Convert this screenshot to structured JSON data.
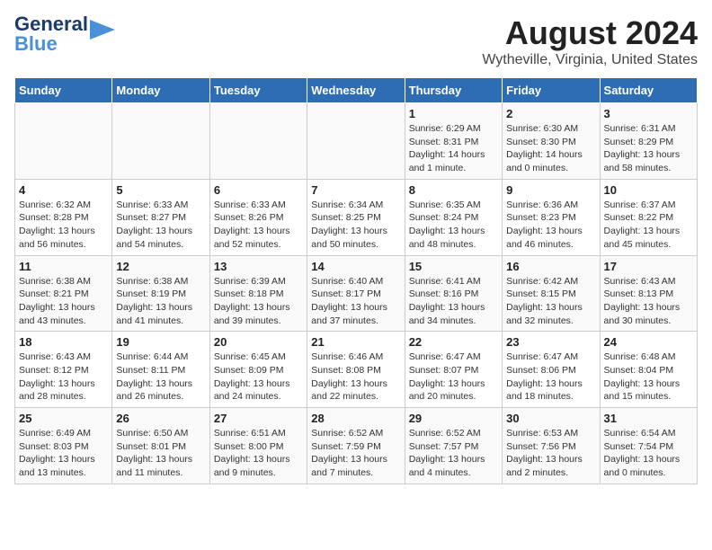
{
  "logo": {
    "line1": "General",
    "line2": "Blue"
  },
  "title": "August 2024",
  "subtitle": "Wytheville, Virginia, United States",
  "weekdays": [
    "Sunday",
    "Monday",
    "Tuesday",
    "Wednesday",
    "Thursday",
    "Friday",
    "Saturday"
  ],
  "weeks": [
    [
      {
        "day": "",
        "info": ""
      },
      {
        "day": "",
        "info": ""
      },
      {
        "day": "",
        "info": ""
      },
      {
        "day": "",
        "info": ""
      },
      {
        "day": "1",
        "info": "Sunrise: 6:29 AM\nSunset: 8:31 PM\nDaylight: 14 hours\nand 1 minute."
      },
      {
        "day": "2",
        "info": "Sunrise: 6:30 AM\nSunset: 8:30 PM\nDaylight: 14 hours\nand 0 minutes."
      },
      {
        "day": "3",
        "info": "Sunrise: 6:31 AM\nSunset: 8:29 PM\nDaylight: 13 hours\nand 58 minutes."
      }
    ],
    [
      {
        "day": "4",
        "info": "Sunrise: 6:32 AM\nSunset: 8:28 PM\nDaylight: 13 hours\nand 56 minutes."
      },
      {
        "day": "5",
        "info": "Sunrise: 6:33 AM\nSunset: 8:27 PM\nDaylight: 13 hours\nand 54 minutes."
      },
      {
        "day": "6",
        "info": "Sunrise: 6:33 AM\nSunset: 8:26 PM\nDaylight: 13 hours\nand 52 minutes."
      },
      {
        "day": "7",
        "info": "Sunrise: 6:34 AM\nSunset: 8:25 PM\nDaylight: 13 hours\nand 50 minutes."
      },
      {
        "day": "8",
        "info": "Sunrise: 6:35 AM\nSunset: 8:24 PM\nDaylight: 13 hours\nand 48 minutes."
      },
      {
        "day": "9",
        "info": "Sunrise: 6:36 AM\nSunset: 8:23 PM\nDaylight: 13 hours\nand 46 minutes."
      },
      {
        "day": "10",
        "info": "Sunrise: 6:37 AM\nSunset: 8:22 PM\nDaylight: 13 hours\nand 45 minutes."
      }
    ],
    [
      {
        "day": "11",
        "info": "Sunrise: 6:38 AM\nSunset: 8:21 PM\nDaylight: 13 hours\nand 43 minutes."
      },
      {
        "day": "12",
        "info": "Sunrise: 6:38 AM\nSunset: 8:19 PM\nDaylight: 13 hours\nand 41 minutes."
      },
      {
        "day": "13",
        "info": "Sunrise: 6:39 AM\nSunset: 8:18 PM\nDaylight: 13 hours\nand 39 minutes."
      },
      {
        "day": "14",
        "info": "Sunrise: 6:40 AM\nSunset: 8:17 PM\nDaylight: 13 hours\nand 37 minutes."
      },
      {
        "day": "15",
        "info": "Sunrise: 6:41 AM\nSunset: 8:16 PM\nDaylight: 13 hours\nand 34 minutes."
      },
      {
        "day": "16",
        "info": "Sunrise: 6:42 AM\nSunset: 8:15 PM\nDaylight: 13 hours\nand 32 minutes."
      },
      {
        "day": "17",
        "info": "Sunrise: 6:43 AM\nSunset: 8:13 PM\nDaylight: 13 hours\nand 30 minutes."
      }
    ],
    [
      {
        "day": "18",
        "info": "Sunrise: 6:43 AM\nSunset: 8:12 PM\nDaylight: 13 hours\nand 28 minutes."
      },
      {
        "day": "19",
        "info": "Sunrise: 6:44 AM\nSunset: 8:11 PM\nDaylight: 13 hours\nand 26 minutes."
      },
      {
        "day": "20",
        "info": "Sunrise: 6:45 AM\nSunset: 8:09 PM\nDaylight: 13 hours\nand 24 minutes."
      },
      {
        "day": "21",
        "info": "Sunrise: 6:46 AM\nSunset: 8:08 PM\nDaylight: 13 hours\nand 22 minutes."
      },
      {
        "day": "22",
        "info": "Sunrise: 6:47 AM\nSunset: 8:07 PM\nDaylight: 13 hours\nand 20 minutes."
      },
      {
        "day": "23",
        "info": "Sunrise: 6:47 AM\nSunset: 8:06 PM\nDaylight: 13 hours\nand 18 minutes."
      },
      {
        "day": "24",
        "info": "Sunrise: 6:48 AM\nSunset: 8:04 PM\nDaylight: 13 hours\nand 15 minutes."
      }
    ],
    [
      {
        "day": "25",
        "info": "Sunrise: 6:49 AM\nSunset: 8:03 PM\nDaylight: 13 hours\nand 13 minutes."
      },
      {
        "day": "26",
        "info": "Sunrise: 6:50 AM\nSunset: 8:01 PM\nDaylight: 13 hours\nand 11 minutes."
      },
      {
        "day": "27",
        "info": "Sunrise: 6:51 AM\nSunset: 8:00 PM\nDaylight: 13 hours\nand 9 minutes."
      },
      {
        "day": "28",
        "info": "Sunrise: 6:52 AM\nSunset: 7:59 PM\nDaylight: 13 hours\nand 7 minutes."
      },
      {
        "day": "29",
        "info": "Sunrise: 6:52 AM\nSunset: 7:57 PM\nDaylight: 13 hours\nand 4 minutes."
      },
      {
        "day": "30",
        "info": "Sunrise: 6:53 AM\nSunset: 7:56 PM\nDaylight: 13 hours\nand 2 minutes."
      },
      {
        "day": "31",
        "info": "Sunrise: 6:54 AM\nSunset: 7:54 PM\nDaylight: 13 hours\nand 0 minutes."
      }
    ]
  ]
}
